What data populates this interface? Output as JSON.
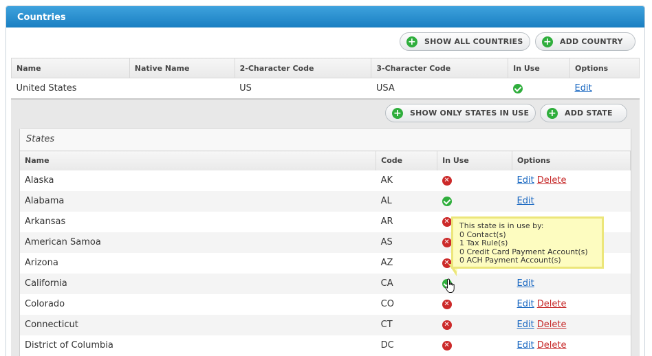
{
  "panel": {
    "title": "Countries"
  },
  "top_buttons": {
    "show_all": "SHOW ALL COUNTRIES",
    "add_country": "ADD COUNTRY"
  },
  "countries_table": {
    "headers": [
      "Name",
      "Native Name",
      "2-Character Code",
      "3-Character Code",
      "In Use",
      "Options"
    ],
    "row": {
      "name": "United States",
      "native_name": "",
      "code2": "US",
      "code3": "USA",
      "in_use": true,
      "edit": "Edit"
    }
  },
  "state_buttons": {
    "show_only": "SHOW ONLY STATES IN USE",
    "add_state": "ADD STATE"
  },
  "states": {
    "title": "States",
    "headers": [
      "Name",
      "Code",
      "In Use",
      "Options"
    ],
    "edit_label": "Edit",
    "delete_label": "Delete",
    "rows": [
      {
        "name": "Alaska",
        "code": "AK",
        "in_use": false
      },
      {
        "name": "Alabama",
        "code": "AL",
        "in_use": true
      },
      {
        "name": "Arkansas",
        "code": "AR",
        "in_use": false
      },
      {
        "name": "American Samoa",
        "code": "AS",
        "in_use": false
      },
      {
        "name": "Arizona",
        "code": "AZ",
        "in_use": false
      },
      {
        "name": "California",
        "code": "CA",
        "in_use": true
      },
      {
        "name": "Colorado",
        "code": "CO",
        "in_use": false
      },
      {
        "name": "Connecticut",
        "code": "CT",
        "in_use": false
      },
      {
        "name": "District of Columbia",
        "code": "DC",
        "in_use": false
      }
    ]
  },
  "tooltip": {
    "heading": "This state is in use by:",
    "lines": [
      "0 Contact(s)",
      "1 Tax Rule(s)",
      "0 Credit Card Payment Account(s)",
      "0 ACH Payment Account(s)"
    ]
  },
  "colors": {
    "header_blue": "#1a7fc2",
    "ok_green": "#2fae3c",
    "no_red": "#cc2a2a",
    "link_blue": "#1565c0",
    "delete_red": "#c62828",
    "tooltip_yellow": "#fdfcc0"
  }
}
